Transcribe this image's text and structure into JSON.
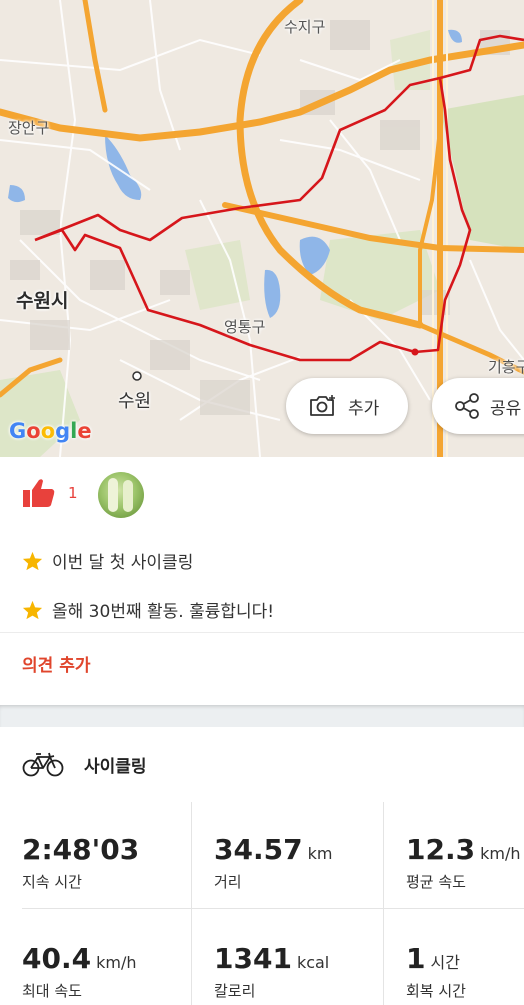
{
  "map": {
    "labels": {
      "suji": "수지구",
      "jangan": "장안구",
      "suwon_si": "수원시",
      "yeongtong": "영통구",
      "suwon_station": "수원",
      "giheung": "기흥구"
    },
    "google_logo": [
      "G",
      "o",
      "o",
      "g",
      "l",
      "e"
    ],
    "add_button": {
      "label": "추가",
      "icon": "camera-plus-icon"
    },
    "share_button": {
      "label": "공유",
      "icon": "share-icon"
    },
    "colors": {
      "route": "#d6161b",
      "highway": "#f4a531",
      "water": "#8fb6e8",
      "park": "#cfe0b4"
    }
  },
  "social": {
    "like_count": "1",
    "like_icon": "thumbs-up-icon",
    "achievements": [
      {
        "icon": "star-icon",
        "text": "이번 달 첫 사이클링"
      },
      {
        "icon": "star-icon",
        "text": "올해 30번째 활동. 훌륭합니다!"
      }
    ],
    "add_comment": "의견 추가",
    "accent": "#e8413c"
  },
  "activity": {
    "type_label": "사이클링",
    "type_icon": "bicycle-icon",
    "stats": [
      {
        "value": "2:48'03",
        "unit": "",
        "caption": "지속 시간"
      },
      {
        "value": "34.57",
        "unit": "km",
        "caption": "거리"
      },
      {
        "value": "12.3",
        "unit": "km/h",
        "caption": "평균 속도"
      },
      {
        "value": "40.4",
        "unit": "km/h",
        "caption": "최대 속도"
      },
      {
        "value": "1341",
        "unit": "kcal",
        "caption": "칼로리"
      },
      {
        "value": "1",
        "unit": "시간",
        "caption": "회복 시간"
      }
    ]
  }
}
